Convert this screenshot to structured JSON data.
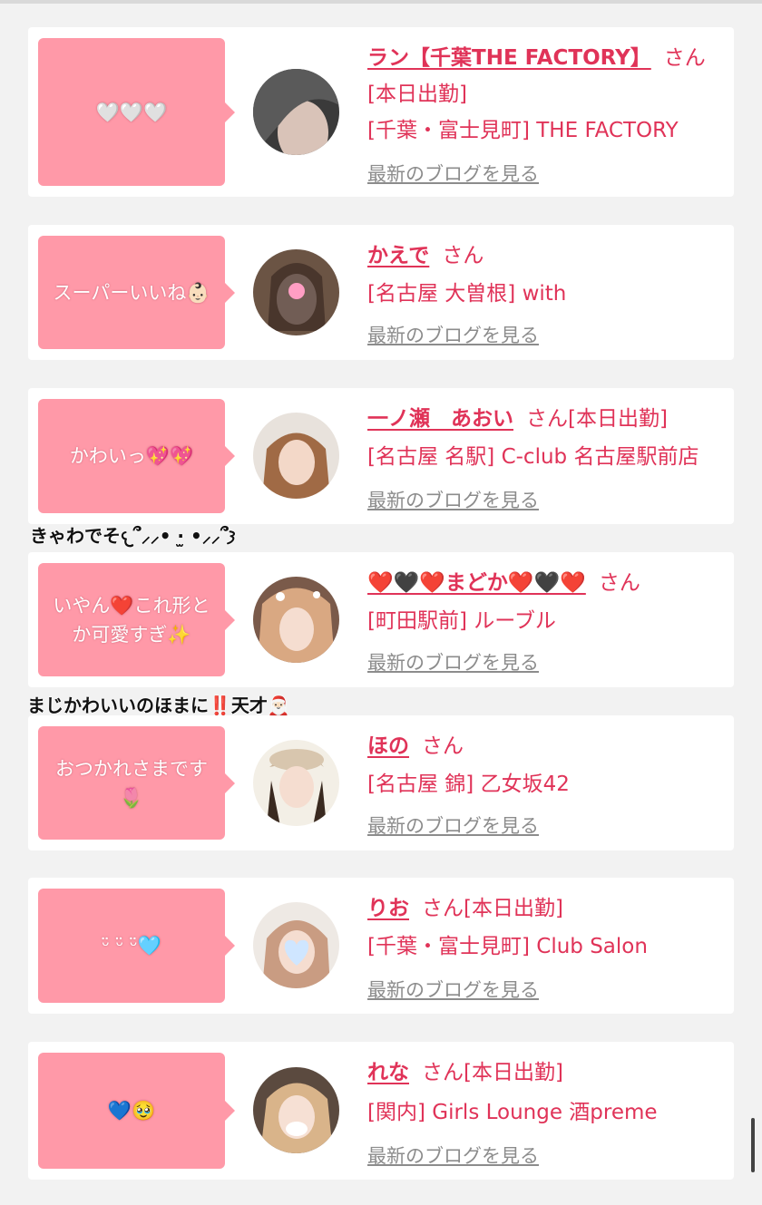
{
  "cards": [
    {
      "bubble": "🤍🤍🤍",
      "name": "ラン【千葉THE FACTORY】",
      "san": "さん",
      "line2": "[本日出勤]",
      "line3": "[千葉・富士見町] THE FACTORY",
      "blog": "最新のブログを見る"
    },
    {
      "bubble": "スーパーいいね👶🏻",
      "name": "かえで",
      "san": "さん",
      "line2": "[名古屋 大曽根] with",
      "blog": "最新のブログを見る"
    },
    {
      "bubble": "かわいっ💖💖",
      "name": "一ノ瀬　あおい",
      "san": "さん[本日出勤]",
      "line2": "[名古屋 名駅] C-club 名古屋駅前店",
      "blog": "最新のブログを見る"
    },
    {
      "bubble": "いやん❤️これ形とか可愛すぎ✨",
      "name": "❤️🖤❤️まどか❤️🖤❤️",
      "san": "さん",
      "line2": "[町田駅前] ルーブル",
      "blog": "最新のブログを見る"
    },
    {
      "bubble": "おつかれさまです🌷",
      "name": "ほの",
      "san": "さん",
      "line2": "[名古屋 錦] 乙女坂42",
      "blog": "最新のブログを見る"
    },
    {
      "bubble": "ᵕ̈ ᵕ̈ ᵕ̈🩵",
      "name": "りお",
      "san": "さん[本日出勤]",
      "line2": "[千葉・富士見町] Club Salon",
      "blog": "最新のブログを見る"
    },
    {
      "bubble": "💙🥹",
      "name": "れな",
      "san": "さん[本日出勤]",
      "line2": "[関内] Girls Lounge 酒preme",
      "blog": "最新のブログを見る"
    }
  ],
  "comments": [
    "きゃわでそ𐔌՞⸝⸝• ·̫ •⸝⸝՞𐦯",
    "まじかわいいのほまに‼️天才🎅🏻"
  ],
  "colors": {
    "accent": "#e03358",
    "bubble": "#ff99a8",
    "background": "#f2f2f2",
    "link_gray": "#8c8c8c"
  }
}
